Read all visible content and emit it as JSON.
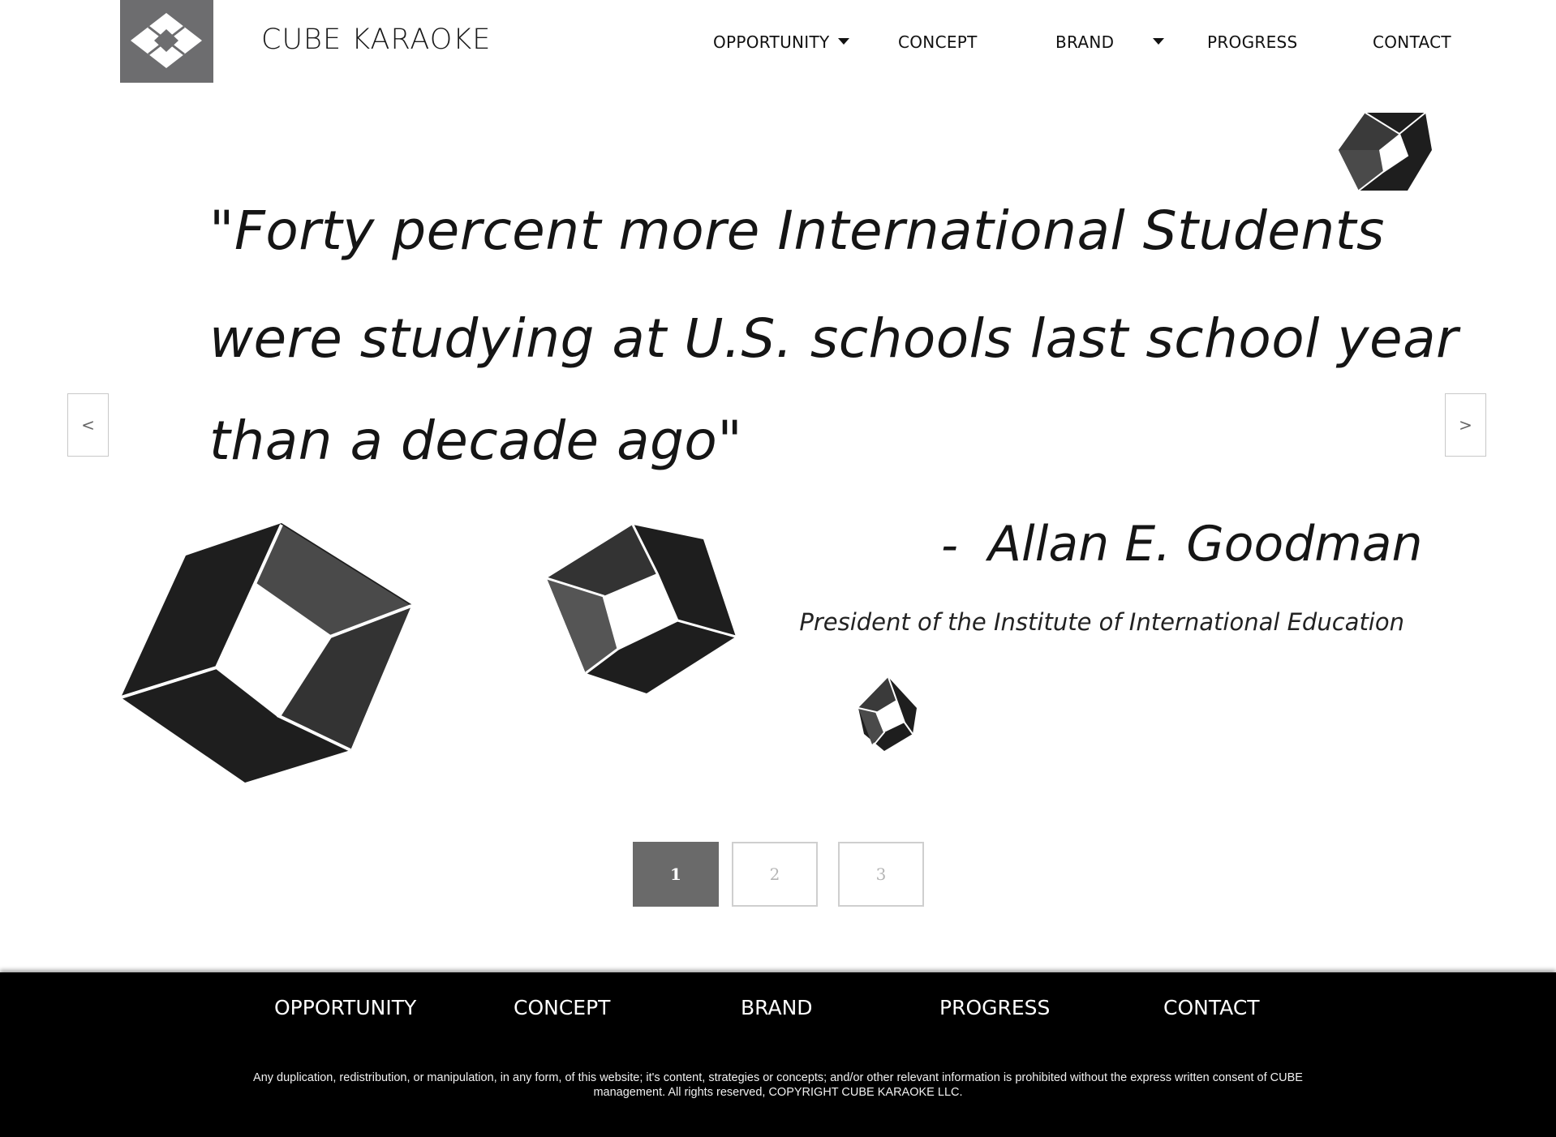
{
  "header": {
    "brand": "CUBE KARAOKE",
    "nav": {
      "opportunity": "OPPORTUNITY",
      "concept": "CONCEPT",
      "brand": "BRAND",
      "progress": "PROGRESS",
      "contact": "CONTACT"
    }
  },
  "slide": {
    "quote_lines": [
      "\"Forty percent more International Students",
      "were studying at U.S. schools last school year",
      "than a decade ago\""
    ],
    "dash": "-",
    "author": "Allan E. Goodman",
    "author_title": "President of the Institute of International Education"
  },
  "carousel": {
    "prev": "<",
    "next": ">",
    "pages": [
      "1",
      "2",
      "3"
    ],
    "active_page": "1"
  },
  "footer": {
    "nav": {
      "opportunity": "OPPORTUNITY",
      "concept": "CONCEPT",
      "brand": "BRAND",
      "progress": "PROGRESS",
      "contact": "CONTACT"
    },
    "copyright": "Any duplication, redistribution, or manipulation, in any form, of this website; it's content, strategies or concepts; and/or other relevant information is prohibited without the express written consent of CUBE management. All rights reserved, COPYRIGHT CUBE KARAOKE LLC."
  },
  "colors": {
    "logo_bg": "#6d6d6f",
    "cube_dark": "#1c1c1c",
    "cube_mid": "#4a4a4a",
    "active_page": "#6a6a6a",
    "footer_bg": "#000000"
  }
}
